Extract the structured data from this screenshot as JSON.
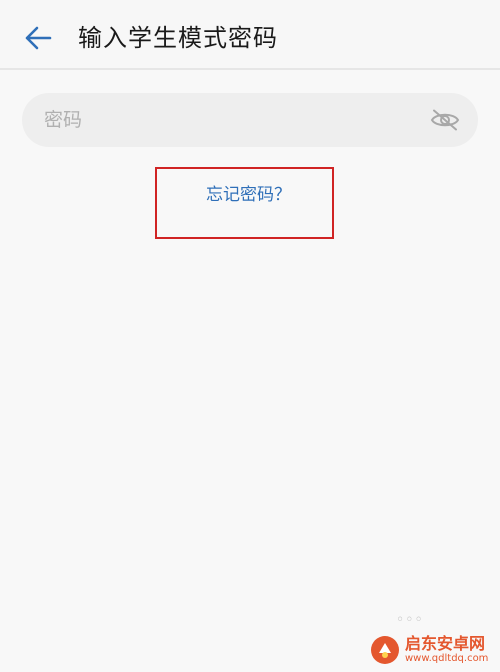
{
  "header": {
    "title": "输入学生模式密码",
    "back_icon": "arrow-left-icon"
  },
  "password": {
    "placeholder": "密码",
    "value": "",
    "visibility_icon": "eye-off-icon"
  },
  "forgot": {
    "label": "忘记密码？"
  },
  "colors": {
    "accent": "#2f6fb8",
    "highlight": "#d02424",
    "watermark": "#e4572e"
  },
  "watermark": {
    "name": "启东安卓网",
    "url": "www.qdltdq.com"
  }
}
